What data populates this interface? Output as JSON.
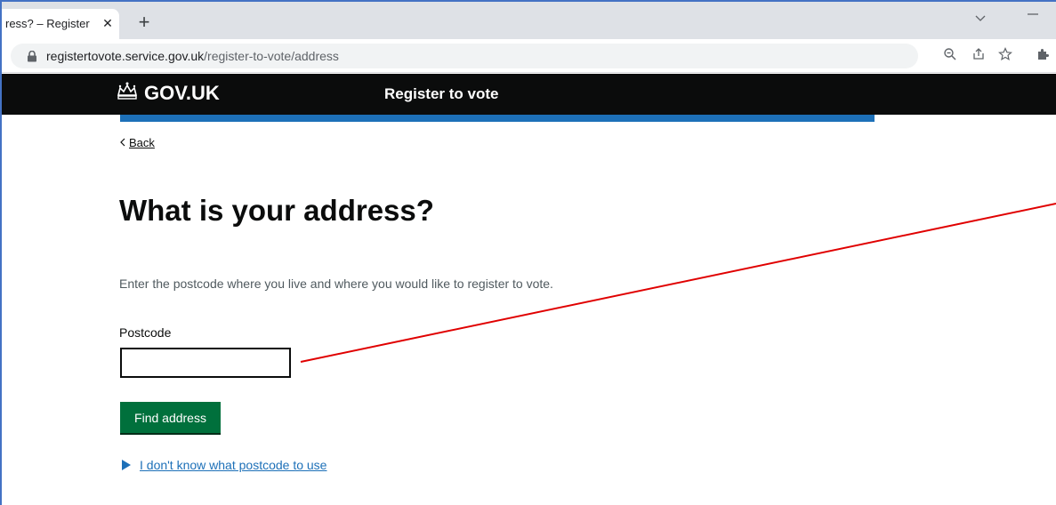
{
  "browser": {
    "tab_title": "ress? – Register",
    "tab_close": "✕",
    "new_tab": "+",
    "url_host": "registertovote.service.gov.uk",
    "url_path": "/register-to-vote/address",
    "icons": [
      "zoom-icon",
      "share-icon",
      "bookmark-star-icon",
      "extensions-icon"
    ]
  },
  "header": {
    "logo_text": "GOV.UK",
    "service_name": "Register to vote",
    "colors": {
      "header_bg": "#0b0c0c",
      "accent_bar": "#1d70b8"
    }
  },
  "main": {
    "back_label": "Back",
    "title": "What is your address?",
    "hint": "Enter the postcode where you live and where you would like to register to vote.",
    "postcode_label": "Postcode",
    "postcode_value": "",
    "find_button": "Find address",
    "details_summary": "I don't know what postcode to use",
    "colors": {
      "button": "#00703c",
      "link": "#1d70b8"
    }
  },
  "annotation": {
    "color": "#e00000"
  }
}
